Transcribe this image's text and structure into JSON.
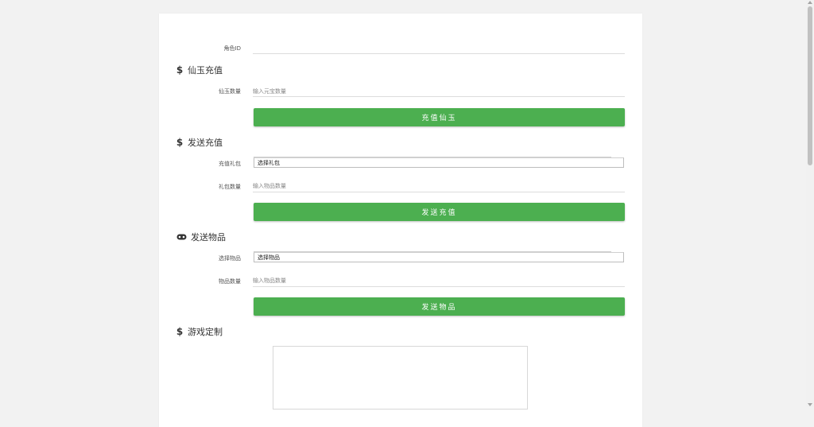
{
  "role": {
    "label": "角色ID",
    "value": ""
  },
  "sections": {
    "jade": {
      "title": "仙玉充值",
      "icon": "dollar-icon"
    },
    "send_recharge": {
      "title": "发送充值",
      "icon": "dollar-icon"
    },
    "send_item": {
      "title": "发送物品",
      "icon": "gamepad-icon"
    },
    "custom": {
      "title": "游戏定制",
      "icon": "dollar-icon"
    }
  },
  "jade": {
    "amount_label": "仙玉数量",
    "amount_placeholder": "输入元宝数量",
    "button": "充值仙玉"
  },
  "send_recharge": {
    "package_label": "充值礼包",
    "package_selected": "选择礼包",
    "qty_label": "礼包数量",
    "qty_placeholder": "输入物品数量",
    "button": "发送充值"
  },
  "send_item": {
    "item_label": "选择物品",
    "item_selected": "选择物品",
    "qty_label": "物品数量",
    "qty_placeholder": "输入物品数量",
    "button": "发送物品"
  },
  "colors": {
    "accent": "#4caf50",
    "background": "#f2f2f2",
    "card": "#ffffff"
  }
}
